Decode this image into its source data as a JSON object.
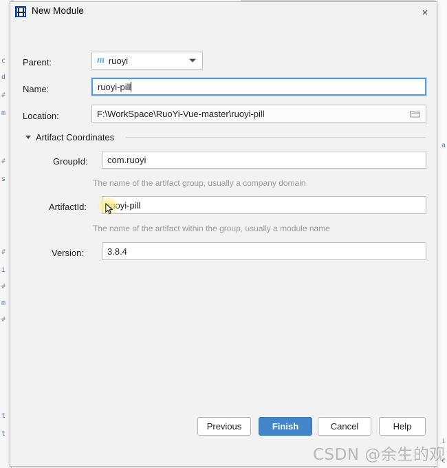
{
  "dialog": {
    "title": "New Module",
    "icon": "module-icon",
    "close_label": "×"
  },
  "form": {
    "parent": {
      "label": "Parent:",
      "value": "ruoyi",
      "icon": "maven-module-icon",
      "arrow_icon": "chevron-down-icon"
    },
    "name": {
      "label": "Name:",
      "value": "ruoyi-pill",
      "placeholder": "",
      "focused": true
    },
    "location": {
      "label": "Location:",
      "value": "F:\\WorkSpace\\RuoYi-Vue-master\\ruoyi-pill",
      "placeholder": "",
      "browse_icon": "folder-icon"
    }
  },
  "artifact_section": {
    "title": "Artifact Coordinates",
    "expanded": true,
    "toggle_icon": "triangle-down-icon",
    "fields": [
      {
        "label": "GroupId:",
        "value": "com.ruoyi",
        "hint": "The name of the artifact group, usually a company domain"
      },
      {
        "label": "ArtifactId:",
        "value": "ruoyi-pill",
        "hint": "The name of the artifact within the group, usually a module name"
      },
      {
        "label": "Version:",
        "value": "3.8.4",
        "hint": ""
      }
    ]
  },
  "footer": {
    "previous_label": "Previous",
    "finish_label": "Finish",
    "cancel_label": "Cancel",
    "help_label": "Help"
  },
  "watermark": {
    "text": "CSDN @余生的观澜"
  },
  "background": {
    "gutter_glyphs": [
      "c",
      "d",
      "#",
      "m",
      "#",
      "s",
      "#",
      "i",
      "#",
      "m",
      "#",
      "-",
      "t",
      "t"
    ],
    "right_glyphs": [
      "a",
      "i",
      "c"
    ]
  },
  "colors": {
    "accent": "#4286c9",
    "focus_border": "#5a9bd4",
    "dialog_bg": "#f2f2f2",
    "field_bg": "#ffffff",
    "hint_text": "#9b9b9b",
    "maven_icon": "#5aa7dd"
  }
}
